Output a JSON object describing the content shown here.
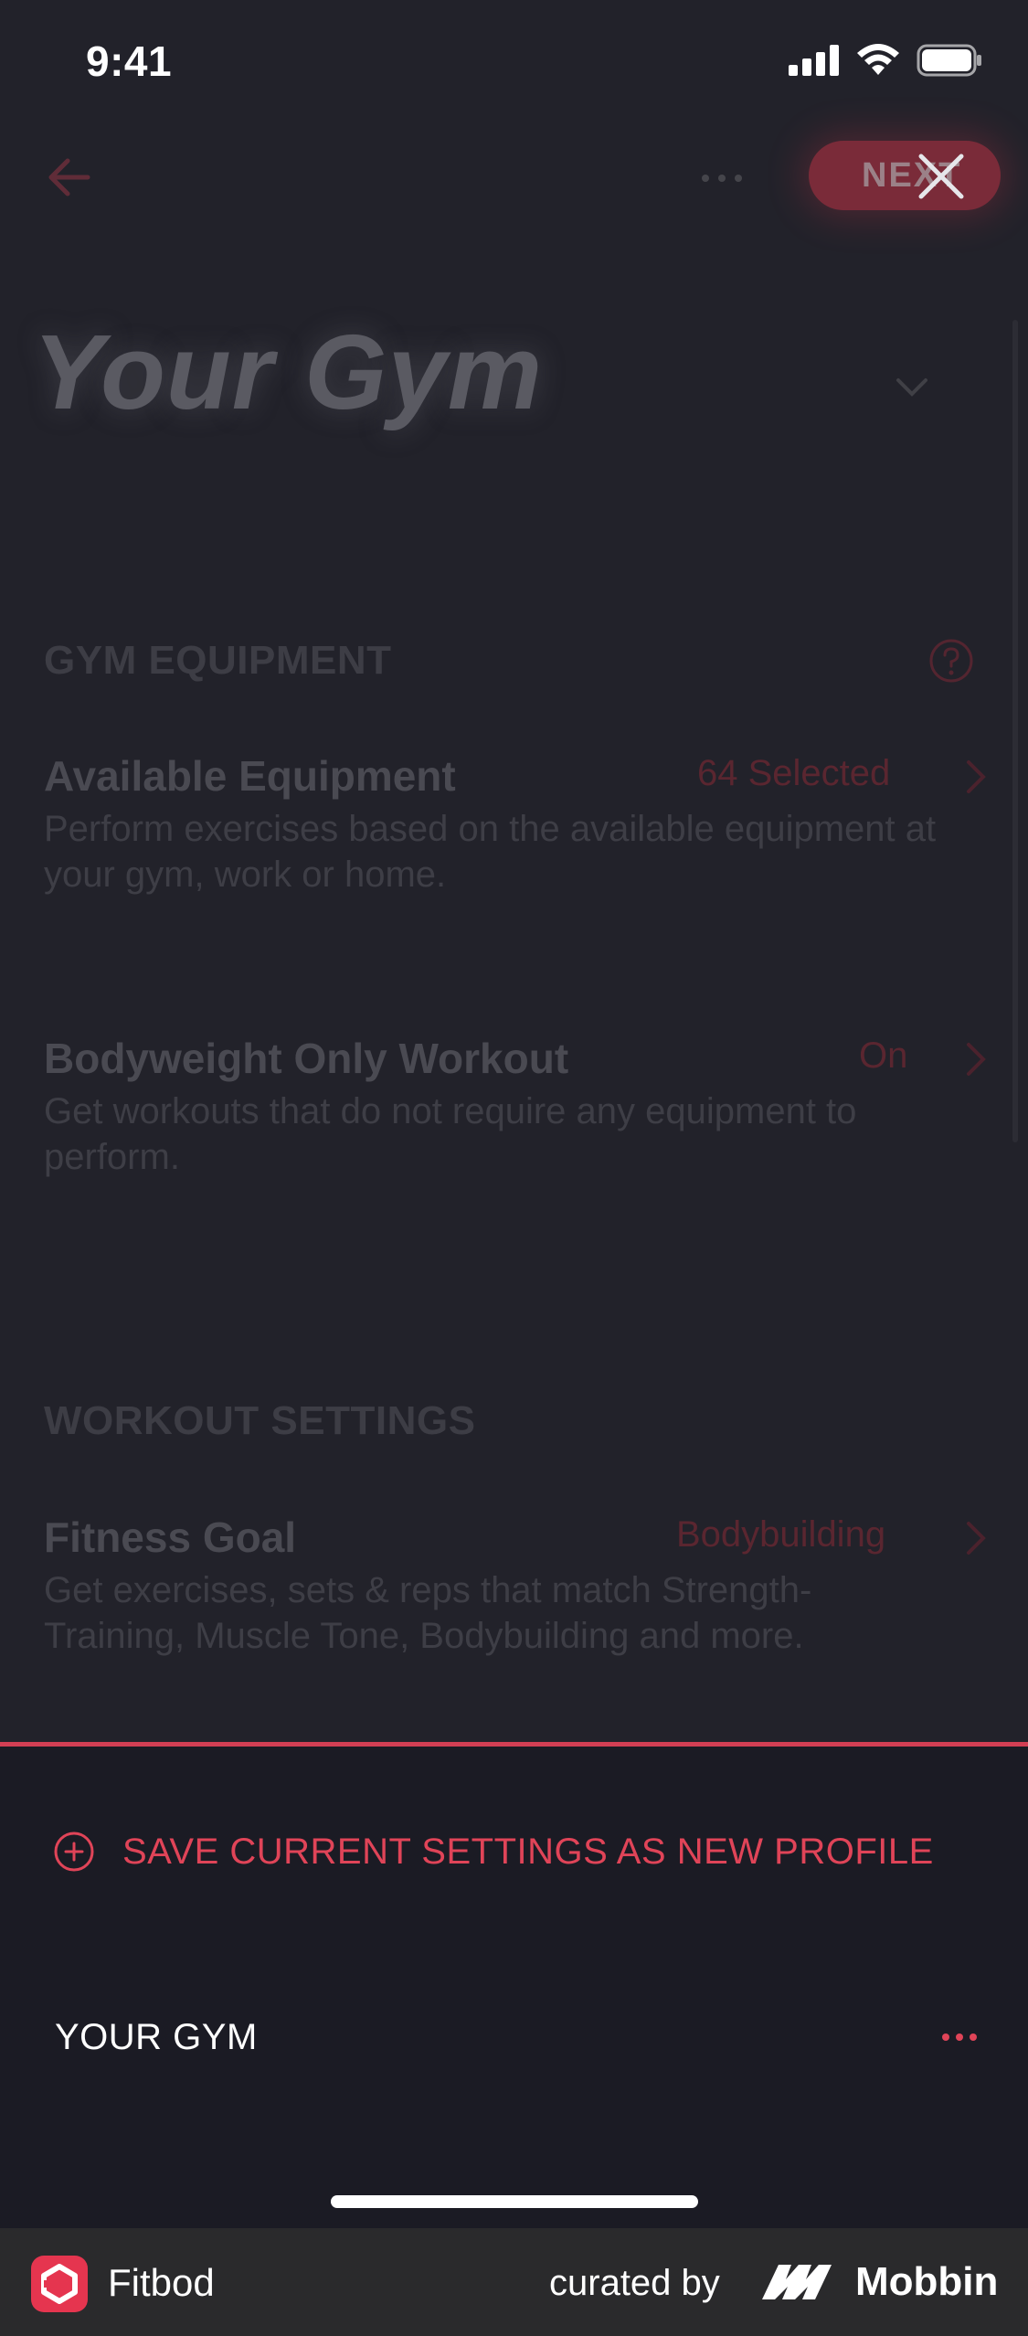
{
  "status_bar": {
    "time": "9:41"
  },
  "top_bar": {
    "next_label": "NEXT"
  },
  "gym": {
    "title": "Your Gym"
  },
  "sections": {
    "equipment_header": "GYM EQUIPMENT",
    "workout_header": "WORKOUT SETTINGS"
  },
  "rows": [
    {
      "title": "Available Equipment",
      "value": "64 Selected",
      "description": "Perform exercises based on the available equipment at your gym, work or home."
    },
    {
      "title": "Bodyweight Only Workout",
      "value": "On",
      "description": "Get workouts that do not require any equipment to perform."
    },
    {
      "title": "Fitness Goal",
      "value": "Bodybuilding",
      "description": "Get exercises, sets & reps that match Strength-Training, Muscle Tone, Bodybuilding and more."
    }
  ],
  "sheet": {
    "save_label": "SAVE CURRENT SETTINGS AS NEW PROFILE",
    "profiles": [
      {
        "name": "YOUR GYM"
      }
    ]
  },
  "footer": {
    "app_name": "Fitbod",
    "curated_label": "curated by",
    "brand_name": "Mobbin"
  },
  "colors": {
    "accent": "#e04458",
    "sheet_bg": "#1b1b24",
    "footer_bg": "#2a2a2c"
  }
}
